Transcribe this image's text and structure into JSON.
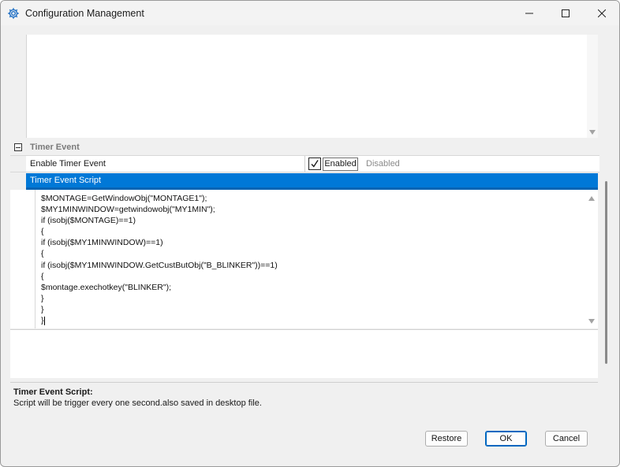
{
  "window": {
    "title": "Configuration Management",
    "icon": "gear-icon",
    "controls": [
      "minimize-icon",
      "maximize-icon",
      "close-icon"
    ]
  },
  "property_grid": {
    "category": {
      "label": "Timer Event",
      "expanded": true
    },
    "rows": [
      {
        "name": "Enable Timer Event",
        "checked": true,
        "enabled_label": "Enabled",
        "disabled_label": "Disabled"
      }
    ],
    "selected_row": {
      "label": "Timer Event Script"
    },
    "script_lines": [
      "$MONTAGE=GetWindowObj(\"MONTAGE1\");",
      "$MY1MINWINDOW=getwindowobj(\"MY1MIN\");",
      "if (isobj($MONTAGE)==1)",
      "{",
      "if (isobj($MY1MINWINDOW)==1)",
      "{",
      "if (isobj($MY1MINWINDOW.GetCustButObj(\"B_BLINKER\"))==1)",
      "{",
      "$montage.exechotkey(\"BLINKER\");",
      "}",
      "}",
      "}"
    ]
  },
  "description": {
    "title": "Timer Event Script:",
    "text": "Script will be trigger every one second.also saved in desktop file."
  },
  "buttons": {
    "restore": "Restore",
    "ok": "OK",
    "cancel": "Cancel"
  },
  "colors": {
    "selection": "#0078d7",
    "window_bg": "#f0f0f0",
    "accent_button_border": "#0067c0"
  }
}
